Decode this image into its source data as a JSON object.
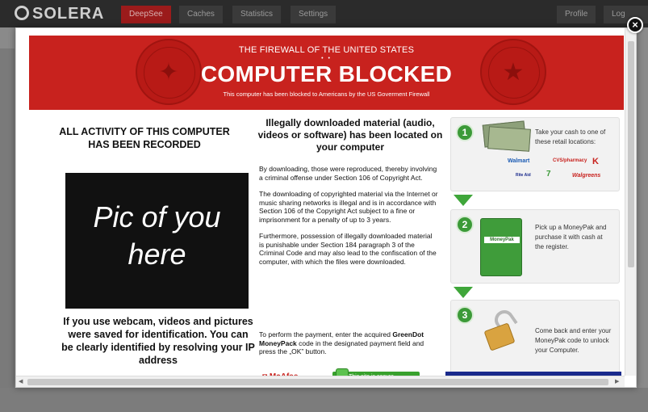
{
  "app": {
    "logo": "SOLERA",
    "nav": [
      "DeepSee",
      "Caches",
      "Statistics",
      "Settings"
    ],
    "nav_right": [
      "Profile",
      "Log Out"
    ]
  },
  "banner": {
    "subtitle": "THE FIREWALL OF THE UNITED STATES",
    "dots": "• •",
    "title": "COMPUTER BLOCKED",
    "note": "This computer has been blocked to Americans by the US Goverment Firewall"
  },
  "left": {
    "heading": "ALL ACTIVITY OF THIS COMPUTER HAS BEEN RECORDED",
    "pic_text": "Pic of you here",
    "footer": "If you use webcam, videos and pictures were saved for identification. You can be clearly identified by resolving your IP address"
  },
  "middle": {
    "heading": "Illegally downloaded material (audio, videos or software) has been located on your computer",
    "paragraphs": [
      "By downloading, those were reproduced, thereby involving a criminal offense under Section 106 of Copyright Act.",
      "The downloading of copyrighted material via the Internet or music sharing networks is illegal and is in accordance with Section 106 of the Copyright Act subject to a fine or imprisonment for a penalty of up to 3 years.",
      "Furthermore, possession of illegally downloaded material is punishable under Section 184 paragraph 3 of the Criminal Code and may also lead to the confiscation of the computer, with which the files were downloaded."
    ],
    "payment_prefix": "To perform the payment, enter the acquired",
    "payment_bold": "GreenDot MoneyPack",
    "payment_suffix": "code in the designated payment field and press the „OK” button.",
    "mcafee": "McAfee",
    "secure_label": "This site is secure"
  },
  "steps": [
    {
      "num": "1",
      "text": "Take your cash to one of these retail locations:"
    },
    {
      "num": "2",
      "text": "Pick up a MoneyPak and purchase it with cash at the register."
    },
    {
      "num": "3",
      "text": "Come back and enter your MoneyPak code to unlock your Computer."
    }
  ],
  "retailers": [
    "Walmart",
    "CVS/pharmacy",
    "K",
    "Rite Aid",
    "7",
    "Walgreens"
  ],
  "card_label": "MoneyPak",
  "colors": {
    "banner_red": "#c8221e",
    "step_green": "#3c9a38",
    "footer_blue": "#1a2a8c"
  }
}
